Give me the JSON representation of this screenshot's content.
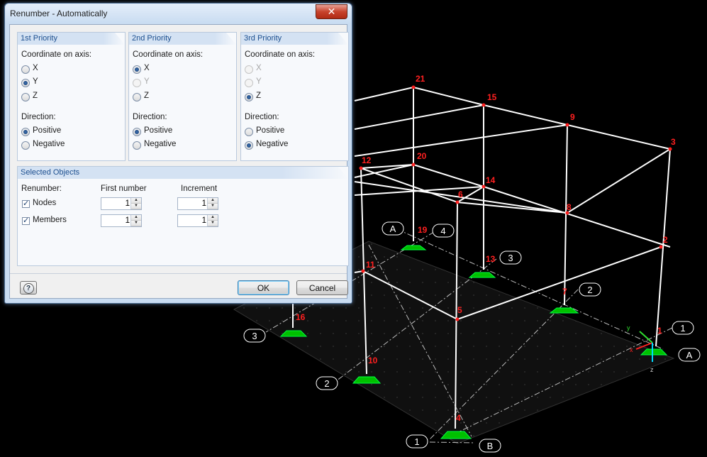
{
  "dialog": {
    "title": "Renumber - Automatically",
    "close_icon": "close-icon",
    "priorities": [
      {
        "header": "1st Priority",
        "coord_label": "Coordinate on axis:",
        "axes": [
          {
            "label": "X",
            "selected": false,
            "enabled": true
          },
          {
            "label": "Y",
            "selected": true,
            "enabled": true
          },
          {
            "label": "Z",
            "selected": false,
            "enabled": true
          }
        ],
        "direction_label": "Direction:",
        "directions": [
          {
            "label": "Positive",
            "selected": true
          },
          {
            "label": "Negative",
            "selected": false
          }
        ]
      },
      {
        "header": "2nd Priority",
        "coord_label": "Coordinate on axis:",
        "axes": [
          {
            "label": "X",
            "selected": true,
            "enabled": true
          },
          {
            "label": "Y",
            "selected": false,
            "enabled": false
          },
          {
            "label": "Z",
            "selected": false,
            "enabled": true
          }
        ],
        "direction_label": "Direction:",
        "directions": [
          {
            "label": "Positive",
            "selected": true
          },
          {
            "label": "Negative",
            "selected": false
          }
        ]
      },
      {
        "header": "3rd Priority",
        "coord_label": "Coordinate on axis:",
        "axes": [
          {
            "label": "X",
            "selected": false,
            "enabled": false
          },
          {
            "label": "Y",
            "selected": false,
            "enabled": false
          },
          {
            "label": "Z",
            "selected": true,
            "enabled": true
          }
        ],
        "direction_label": "Direction:",
        "directions": [
          {
            "label": "Positive",
            "selected": false
          },
          {
            "label": "Negative",
            "selected": true
          }
        ]
      }
    ],
    "selected_objects": {
      "header": "Selected Objects",
      "renumber_label": "Renumber:",
      "first_number_label": "First number",
      "increment_label": "Increment",
      "rows": [
        {
          "label": "Nodes",
          "checked": true,
          "first": "1",
          "increment": "1"
        },
        {
          "label": "Members",
          "checked": true,
          "first": "1",
          "increment": "1"
        }
      ]
    },
    "buttons": {
      "ok": "OK",
      "cancel": "Cancel",
      "help_icon": "help-icon"
    }
  },
  "model": {
    "node_labels": [
      "1",
      "2",
      "3",
      "4",
      "5",
      "6",
      "7",
      "8",
      "9",
      "10",
      "11",
      "12",
      "13",
      "14",
      "15",
      "16",
      "19",
      "20",
      "21"
    ],
    "grid_labels": [
      "A",
      "4",
      "3",
      "2",
      "1",
      "A",
      "2",
      "3",
      "1",
      "B"
    ],
    "axis_labels": [
      "x",
      "y",
      "z"
    ],
    "colors": {
      "background": "#000000",
      "member": "#ffffff",
      "node_label": "#ff1a1a",
      "support": "#00c800",
      "grid_line": "#c8c8c8"
    }
  }
}
